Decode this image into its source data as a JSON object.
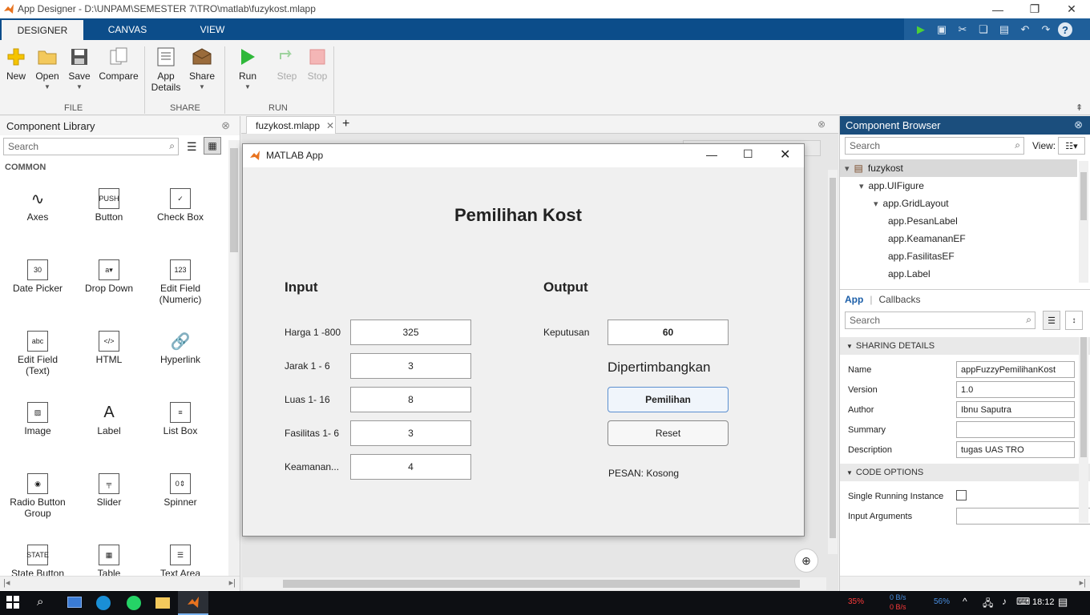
{
  "window": {
    "title": "App Designer - D:\\UNPAM\\SEMESTER 7\\TRO\\matlab\\fuzykost.mlapp"
  },
  "tabs": [
    {
      "label": "DESIGNER"
    },
    {
      "label": "CANVAS"
    },
    {
      "label": "VIEW"
    }
  ],
  "ribbon": {
    "file": {
      "group": "FILE",
      "new": "New",
      "open": "Open",
      "save": "Save",
      "compare": "Compare"
    },
    "share": {
      "group": "SHARE",
      "app_details_1": "App",
      "app_details_2": "Details",
      "share": "Share"
    },
    "run": {
      "group": "RUN",
      "run": "Run",
      "step": "Step",
      "stop": "Stop"
    }
  },
  "library": {
    "title": "Component Library",
    "search_placeholder": "Search",
    "section": "COMMON",
    "items": [
      {
        "label": "Axes",
        "icon": "axes-icon"
      },
      {
        "label": "Button",
        "icon": "push-button-icon"
      },
      {
        "label": "Check Box",
        "icon": "checkbox-icon"
      },
      {
        "label": "Date Picker",
        "icon": "date-picker-icon"
      },
      {
        "label": "Drop Down",
        "icon": "dropdown-icon"
      },
      {
        "label": "Edit Field\n(Numeric)",
        "icon": "numeric-field-icon"
      },
      {
        "label": "Edit Field\n(Text)",
        "icon": "text-field-icon"
      },
      {
        "label": "HTML",
        "icon": "html-icon"
      },
      {
        "label": "Hyperlink",
        "icon": "hyperlink-icon"
      },
      {
        "label": "Image",
        "icon": "image-icon"
      },
      {
        "label": "Label",
        "icon": "label-icon"
      },
      {
        "label": "List Box",
        "icon": "listbox-icon"
      },
      {
        "label": "Radio Button\nGroup",
        "icon": "radio-group-icon"
      },
      {
        "label": "Slider",
        "icon": "slider-icon"
      },
      {
        "label": "Spinner",
        "icon": "spinner-icon"
      },
      {
        "label": "State Button",
        "icon": "state-button-icon"
      },
      {
        "label": "Table",
        "icon": "table-icon"
      },
      {
        "label": "Text Area",
        "icon": "text-area-icon"
      }
    ],
    "icon_text": {
      "button": "PUSH",
      "date": "30",
      "numeric": "123",
      "text": "abc",
      "html": "</>",
      "spinner": "0",
      "state": "STATE"
    }
  },
  "doc_tab": {
    "label": "fuzykost.mlapp"
  },
  "app": {
    "window_title": "MATLAB App",
    "heading": "Pemilihan Kost",
    "input_title": "Input",
    "output_title": "Output",
    "inputs": [
      {
        "label": "Harga 1 -800",
        "value": "325"
      },
      {
        "label": "Jarak 1 - 6",
        "value": "3"
      },
      {
        "label": "Luas 1- 16",
        "value": "8"
      },
      {
        "label": "Fasilitas 1- 6",
        "value": "3"
      },
      {
        "label": "Keamanan...",
        "value": "4"
      }
    ],
    "keputusan_label": "Keputusan",
    "keputusan_value": "60",
    "status_text": "Dipertimbangkan",
    "pemilihan_button": "Pemilihan",
    "reset_button": "Reset",
    "pesan": "PESAN: Kosong"
  },
  "browser": {
    "title": "Component Browser",
    "search_placeholder": "Search",
    "view_label": "View:",
    "tree": [
      {
        "label": "fuzykost",
        "level": 0
      },
      {
        "label": "app.UIFigure",
        "level": 1
      },
      {
        "label": "app.GridLayout",
        "level": 2
      },
      {
        "label": "app.PesanLabel",
        "level": 3
      },
      {
        "label": "app.KeamananEF",
        "level": 3
      },
      {
        "label": "app.FasilitasEF",
        "level": 3
      },
      {
        "label": "app.Label",
        "level": 3
      }
    ],
    "subtabs": {
      "app": "App",
      "callbacks": "Callbacks"
    },
    "search2_placeholder": "Search",
    "sharing_section": "SHARING DETAILS",
    "name_label": "Name",
    "name_value": "appFuzzyPemilihanKost",
    "version_label": "Version",
    "version_value": "1.0",
    "author_label": "Author",
    "author_value": "Ibnu Saputra",
    "summary_label": "Summary",
    "summary_value": "",
    "description_label": "Description",
    "description_value": "tugas UAS TRO",
    "code_section": "CODE OPTIONS",
    "single_label": "Single Running Instance",
    "input_args_label": "Input Arguments",
    "input_args_value": ""
  },
  "taskbar": {
    "cpu": "35%",
    "net_up": "0 B/s",
    "net_down": "0 B/s",
    "mem": "56%",
    "time": "18:12"
  },
  "colors": {
    "tab_bar": "#0c4d8a",
    "browser_header": "#1b4e7d",
    "taskbar": "#0d0f13",
    "net_red": "#ff3b3b",
    "mem_blue": "#4a90e2"
  }
}
